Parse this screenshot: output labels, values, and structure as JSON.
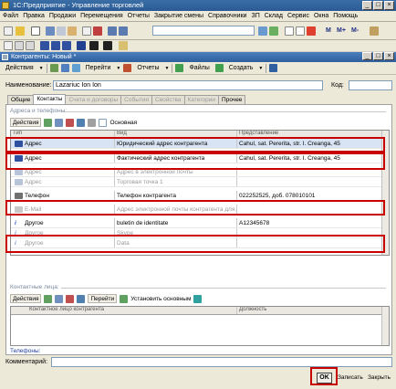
{
  "app": {
    "title": "1С:Предприятие - Управление торговлей"
  },
  "menu": [
    "Файл",
    "Правка",
    "Продажи",
    "Перемещения",
    "Отчеты",
    "Закрытие смены",
    "Справочники",
    "ЗП",
    "Склад",
    "Сервис",
    "Окна",
    "Помощь"
  ],
  "toolbar_letters": {
    "m1": "M",
    "m2": "M+",
    "m3": "M-"
  },
  "window": {
    "title": "Контрагенты: Новый *"
  },
  "form_toolbar": {
    "actions": "Действия",
    "goto": "Перейти",
    "reports": "Отчеты",
    "files": "Файлы",
    "create": "Создать"
  },
  "fields": {
    "name_label": "Наименование:",
    "name_value": "Lazariuc Ion Ion",
    "code_label": "Код:",
    "code_value": ""
  },
  "tabs": [
    "Общие",
    "Контакты",
    "Счета и договоры",
    "События",
    "Свойства",
    "Категории",
    "Прочее"
  ],
  "addresses": {
    "section_title": "Адреса и телефоны:",
    "actions": "Действия",
    "main_label": "Основная",
    "columns": [
      "Тип",
      "Вид",
      "Представление"
    ],
    "rows": [
      {
        "type": "Адрес",
        "kind": "Юридический адрес контрагента",
        "value": "Cahul, sat. Pererita, str. I. Creanga, 45"
      },
      {
        "type": "Адрес",
        "kind": "Фактический адрес контрагента",
        "value": "Cahul, sat. Pererita, str. I. Creanga, 45"
      },
      {
        "type": "Адрес",
        "kind": "Адрес в электронной почты",
        "value": ""
      },
      {
        "type": "Адрес",
        "kind": "Торговая точка 1",
        "value": ""
      },
      {
        "type": "Телефон",
        "kind": "Телефон контрагента",
        "value": "022252525, доб. 078010101"
      },
      {
        "type": "E-Mail",
        "kind": "Адрес электронной почты контрагента для...",
        "value": ""
      },
      {
        "type": "Другое",
        "kind": "buletin de identitate",
        "value": "A12345678"
      },
      {
        "type": "Другое",
        "kind": "Skype",
        "value": ""
      },
      {
        "type": "Другое",
        "kind": "Data",
        "value": ""
      }
    ]
  },
  "contacts": {
    "section_title": "Контактные лица:",
    "actions": "Действия",
    "goto": "Перейти",
    "set_main": "Установить основным",
    "columns": [
      "Контактное лицо контрагента",
      "Должность"
    ],
    "phones_label": "Телефоны:"
  },
  "footer": {
    "comment_label": "Комментарий:",
    "comment_value": "",
    "ok": "OK",
    "save": "Записать",
    "close": "Закрыть"
  }
}
